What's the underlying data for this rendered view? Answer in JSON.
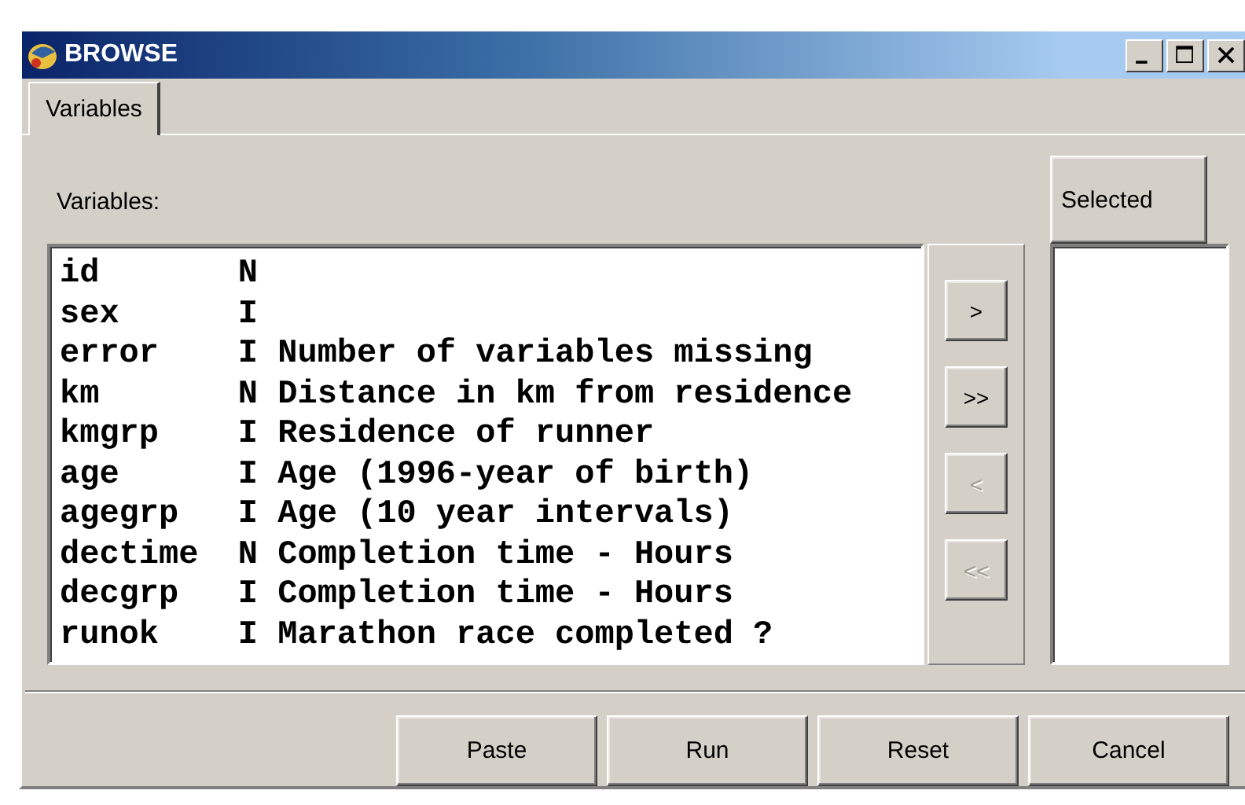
{
  "window": {
    "title": "BROWSE"
  },
  "tabs": [
    {
      "label": "Variables",
      "selected": true
    }
  ],
  "variables_label": "Variables:",
  "variables": [
    {
      "name": "id",
      "type": "N"
    },
    {
      "name": "sex",
      "type": "I"
    },
    {
      "name": "error",
      "type": "I",
      "label": "Number of variables missing"
    },
    {
      "name": "km",
      "type": "N",
      "label": "Distance in km from residence"
    },
    {
      "name": "kmgrp",
      "type": "I",
      "label": "Residence of runner"
    },
    {
      "name": "age",
      "type": "I",
      "label": "Age (1996-year of birth)"
    },
    {
      "name": "agegrp",
      "type": "I",
      "label": "Age (10 year intervals)"
    },
    {
      "name": "dectime",
      "type": "N",
      "label": "Completion time - Hours"
    },
    {
      "name": "decgrp",
      "type": "I",
      "label": "Completion time - Hours"
    },
    {
      "name": "runok",
      "type": "I",
      "label": "Marathon race completed ?"
    }
  ],
  "move_buttons": [
    {
      "label": ">",
      "disabled": false
    },
    {
      "label": ">>",
      "disabled": false
    },
    {
      "label": "<",
      "disabled": true
    },
    {
      "label": "<<",
      "disabled": true
    }
  ],
  "selected_label": "Selected",
  "buttons": [
    "Paste",
    "Run",
    "Reset",
    "Cancel"
  ]
}
